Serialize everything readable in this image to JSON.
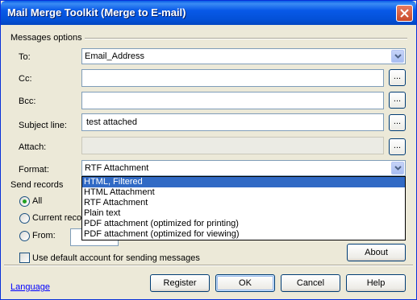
{
  "window": {
    "title": "Mail Merge Toolkit (Merge to E-mail)"
  },
  "messages_options": {
    "group_label": "Messages options",
    "to": {
      "label": "To:",
      "value": "Email_Address"
    },
    "cc": {
      "label": "Cc:",
      "value": ""
    },
    "bcc": {
      "label": "Bcc:",
      "value": ""
    },
    "subject": {
      "label": "Subject line:",
      "value": "test attached"
    },
    "attach": {
      "label": "Attach:",
      "value": ""
    },
    "format": {
      "label": "Format:",
      "value": "RTF Attachment",
      "options": [
        "HTML, Filtered",
        "HTML Attachment",
        "RTF Attachment",
        "Plain text",
        "PDF attachment (optimized for printing)",
        "PDF attachment (optimized for viewing)"
      ],
      "highlighted_option": "HTML, Filtered"
    },
    "browse_label": "..."
  },
  "send_records": {
    "group_label": "Send records",
    "all_label": "All",
    "current_label": "Current recor",
    "from_label": "From:",
    "selected": "All"
  },
  "default_account_label": "Use default account for sending messages",
  "buttons": {
    "about": "About",
    "register": "Register",
    "ok": "OK",
    "cancel": "Cancel",
    "help": "Help"
  },
  "language_link": "Language",
  "colors": {
    "titlebar": "#0859e8",
    "selection": "#316ac5",
    "dialog_bg": "#ece9d8",
    "link": "#0000ff"
  }
}
